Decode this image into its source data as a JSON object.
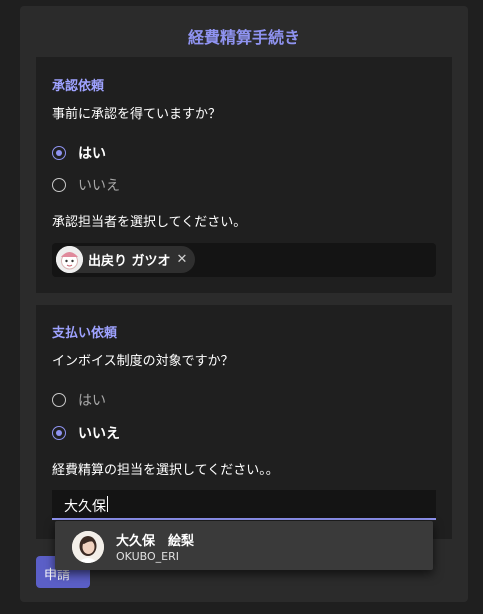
{
  "form": {
    "title": "経費精算手続き",
    "submit_label": "申請"
  },
  "approval": {
    "title": "承認依頼",
    "question": "事前に承認を得ていますか？",
    "options": [
      "はい",
      "いいえ"
    ],
    "selected": "はい",
    "approver_label": "承認担当者を選択してください。",
    "approver_selected": "出戻り ガツオ"
  },
  "payment": {
    "title": "支払い依頼",
    "question": "インボイス制度の対象ですか？",
    "options": [
      "はい",
      "いいえ"
    ],
    "selected": "いいえ",
    "owner_label": "経費精算の担当を選択してください。。",
    "search_value": "大久保"
  },
  "suggestion": {
    "name": "大久保　絵梨",
    "id": "OKUBO_ERI"
  },
  "colors": {
    "accent": "#8f93f0",
    "button": "#5b5fc7"
  }
}
